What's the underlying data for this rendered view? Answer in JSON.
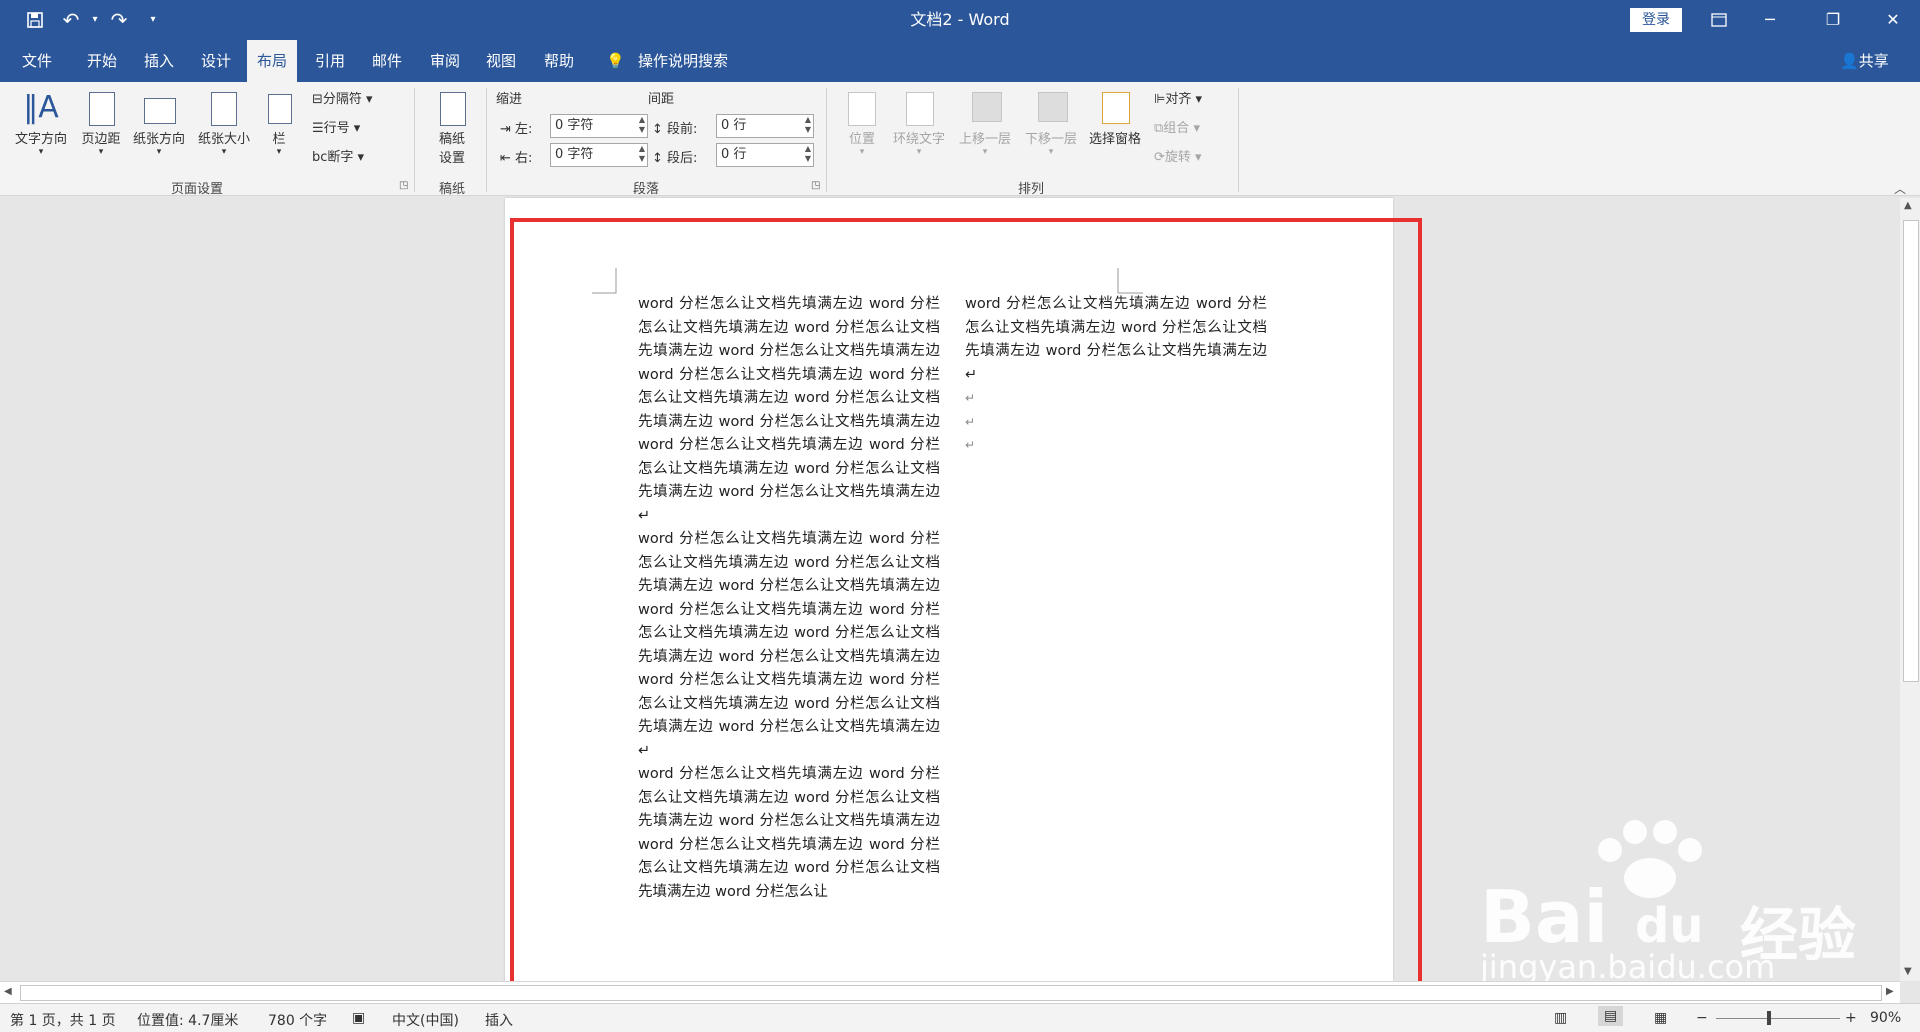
{
  "titlebar": {
    "title": "文档2 - Word",
    "login": "登录"
  },
  "tabs": [
    "文件",
    "开始",
    "插入",
    "设计",
    "布局",
    "引用",
    "邮件",
    "审阅",
    "视图",
    "帮助"
  ],
  "search": "操作说明搜索",
  "share": "共享",
  "ribbon": {
    "page_setup": {
      "text_direction": "文字方向",
      "margins": "页边距",
      "orientation": "纸张方向",
      "size": "纸张大小",
      "columns": "栏",
      "breaks": "分隔符",
      "line_numbers": "行号",
      "hyphenation": "断字",
      "group": "页面设置"
    },
    "manuscript": {
      "button_line1": "稿纸",
      "button_line2": "设置",
      "group": "稿纸"
    },
    "paragraph": {
      "indent": "缩进",
      "spacing": "间距",
      "left": "左:",
      "right": "右:",
      "before": "段前:",
      "after": "段后:",
      "left_val": "0 字符",
      "right_val": "0 字符",
      "before_val": "0 行",
      "after_val": "0 行",
      "group": "段落"
    },
    "arrange": {
      "position": "位置",
      "wrap": "环绕文字",
      "forward": "上移一层",
      "backward": "下移一层",
      "selection_pane": "选择窗格",
      "align": "对齐",
      "group_btn": "组合",
      "rotate": "旋转",
      "group": "排列"
    }
  },
  "document": {
    "left_column": [
      "word 分栏怎么让文档先填满左边 word 分栏怎么让文档先填满左边 word 分栏怎么让文档先填满左边 word 分栏怎么让文档先填满左边 word 分栏怎么让文档先填满左边 word 分栏怎么让文档先填满左边 word 分栏怎么让文档先填满左边 word 分栏怎么让文档先填满左边 word 分栏怎么让文档先填满左边 word 分栏怎么让文档先填满左边 word 分栏怎么让文档先填满左边 word 分栏怎么让文档先填满左边↵",
      "word 分栏怎么让文档先填满左边 word 分栏怎么让文档先填满左边 word 分栏怎么让文档先填满左边 word 分栏怎么让文档先填满左边 word 分栏怎么让文档先填满左边 word 分栏怎么让文档先填满左边 word 分栏怎么让文档先填满左边 word 分栏怎么让文档先填满左边 word 分栏怎么让文档先填满左边 word 分栏怎么让文档先填满左边 word 分栏怎么让文档先填满左边 word 分栏怎么让文档先填满左边↵",
      "word 分栏怎么让文档先填满左边 word 分栏怎么让文档先填满左边 word 分栏怎么让文档先填满左边 word 分栏怎么让文档先填满左边 word 分栏怎么让文档先填满左边 word 分栏怎么让文档先填满左边 word 分栏怎么让文档先填满左边 word 分栏怎么让"
    ],
    "right_column": "word 分栏怎么让文档先填满左边 word 分栏怎么让文档先填满左边 word 分栏怎么让文档先填满左边 word 分栏怎么让文档先填满左边↵",
    "paragraph_mark": "↵"
  },
  "status": {
    "page": "第 1 页，共 1 页",
    "position": "位置值: 4.7厘米",
    "words": "780 个字",
    "language": "中文(中国)",
    "mode": "插入",
    "zoom": "90%"
  },
  "watermark": {
    "brand": "Bai",
    "du": "du",
    "cn": "经验",
    "url": "jingyan.baidu.com"
  },
  "colors": {
    "accent": "#2b579a",
    "highlight_box": "#e83030"
  }
}
